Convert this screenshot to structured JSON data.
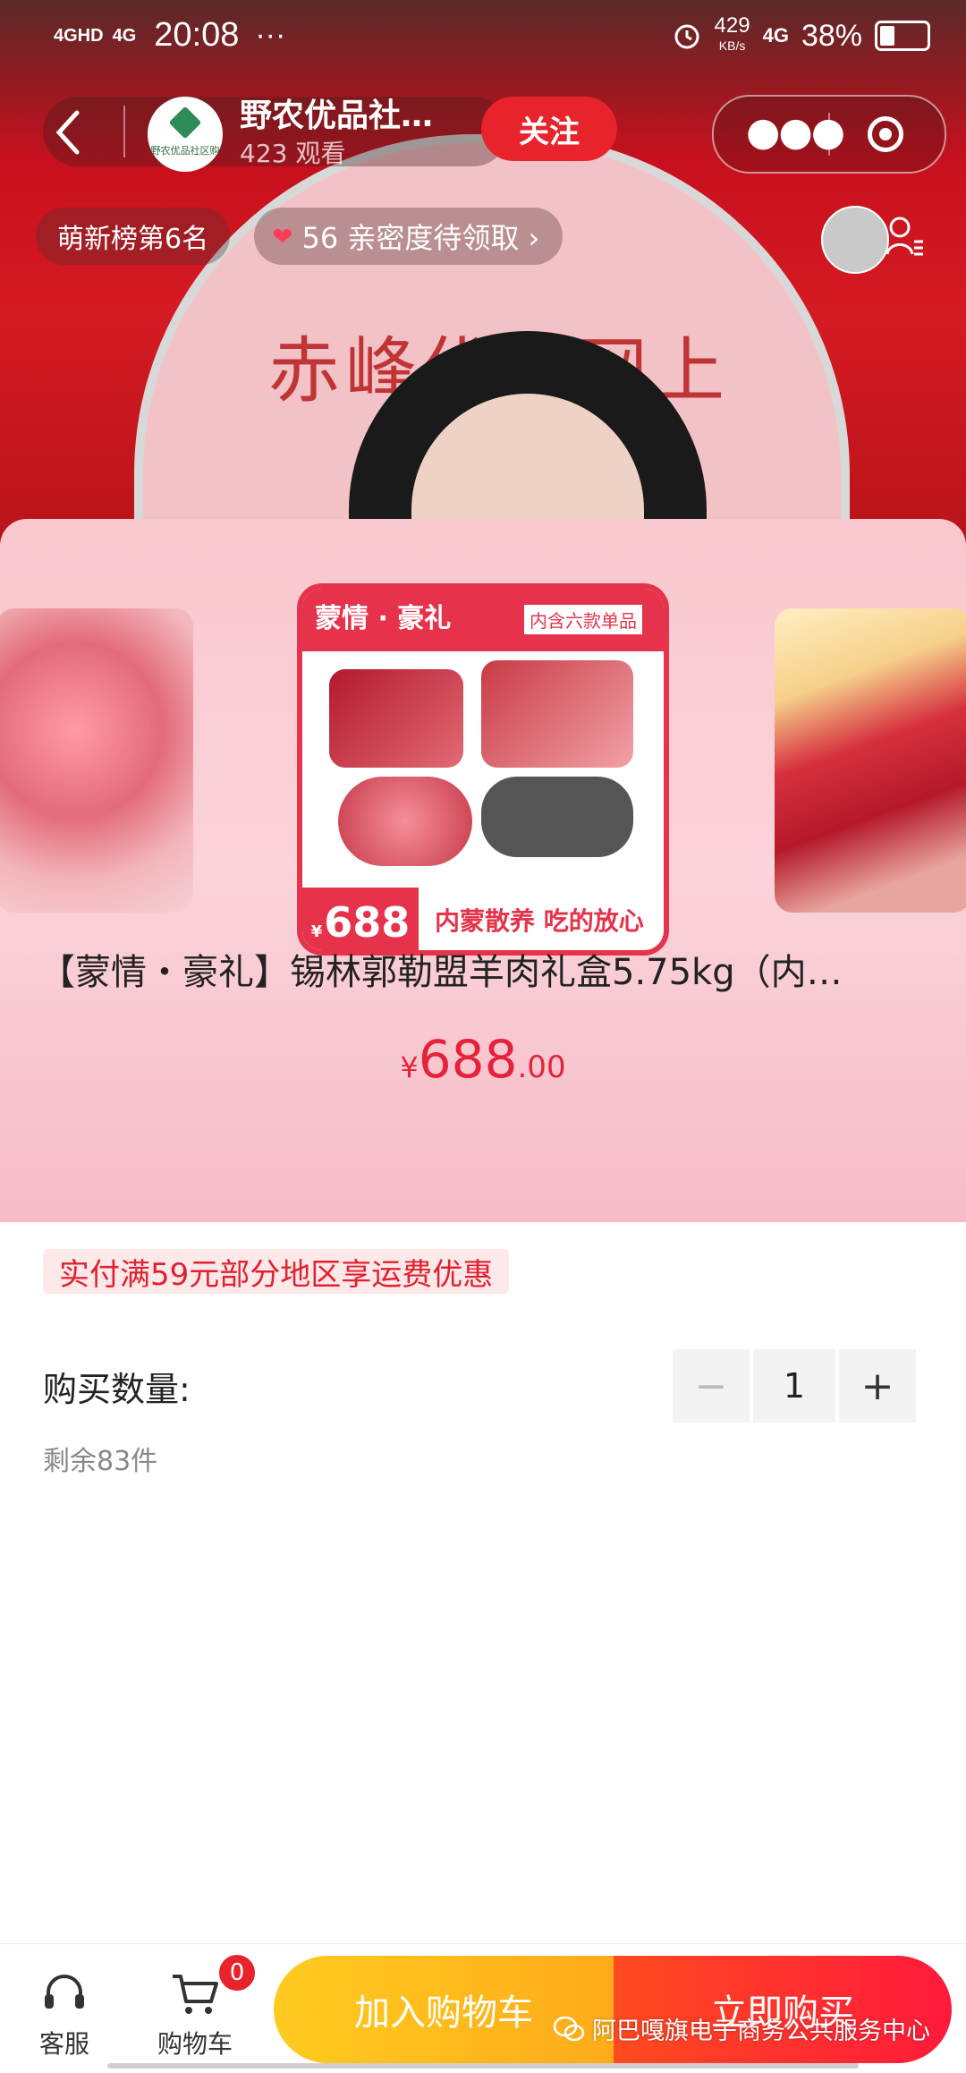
{
  "status_bar": {
    "signal_1": "4GHD",
    "signal_2": "4G",
    "time": "20:08",
    "dots": "···",
    "speed": "429",
    "speed_unit": "KB/s",
    "net": "4G",
    "battery": "38%",
    "battery_level": 0.38
  },
  "live": {
    "banner_text": "赤峰优品网上",
    "host_name": "野农优品社…",
    "avatar_caption": "野农优品社区购",
    "viewers": "423 观看",
    "follow_label": "关注",
    "rank_label": "萌新榜第6名",
    "intimacy_label": "56 亲密度待领取 ›"
  },
  "product": {
    "image_title": "蒙情 · 豪礼",
    "image_sub": "内含六款单品",
    "image_price": "688",
    "image_slogan": "内蒙散养 吃的放心",
    "title": "【蒙情・豪礼】锡林郭勒盟羊肉礼盒5.75kg（内…",
    "price_currency": "¥",
    "price_int": "688",
    "price_dec": ".00"
  },
  "promo": {
    "text": "实付满59元部分地区享运费优惠"
  },
  "quantity": {
    "label": "购买数量:",
    "minus": "−",
    "value": "1",
    "plus": "+",
    "remaining": "剩余83件"
  },
  "bottom_bar": {
    "service_label": "客服",
    "cart_label": "购物车",
    "cart_count": "0",
    "add_to_cart_label": "加入购物车",
    "buy_now_label": "立即购买",
    "watermark": "阿巴嘎旗电子商务公共服务中心"
  },
  "colors": {
    "accent_red": "#e8232b",
    "price_red": "#e6223a",
    "add_cart_yellow": "#ffb81c",
    "sheet_pink": "#f9c7ce"
  }
}
